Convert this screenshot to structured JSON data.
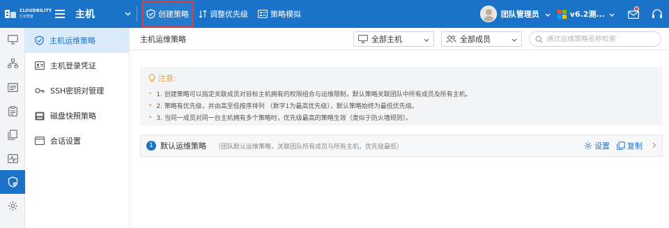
{
  "colors": {
    "brand": "#1a73c9",
    "highlight_outline": "#e23b3b",
    "notice_accent": "#e8a23a",
    "active_submenu_bg": "#dcebfa"
  },
  "logo": {
    "en": "CLOUDBILITY",
    "cn": "行云管家"
  },
  "topbar": {
    "module_title": "主机",
    "create_policy": "创建策略",
    "adjust_priority": "调整优先级",
    "policy_simulation": "策略模拟",
    "user_name": "团队管理员",
    "version": "v6.2测..."
  },
  "rail": {
    "items": [
      "monitor-icon",
      "org-tree-icon",
      "list-icon",
      "clipboard-icon",
      "copy-icon",
      "pulse-icon",
      "shield-icon",
      "settings-icon"
    ],
    "active_index": 6
  },
  "submenu": {
    "items": [
      {
        "label": "主机运维策略",
        "icon": "shield-check-icon"
      },
      {
        "label": "主机登录凭证",
        "icon": "credential-icon"
      },
      {
        "label": "SSH密钥对管理",
        "icon": "key-icon"
      },
      {
        "label": "磁盘快照策略",
        "icon": "disk-snapshot-icon"
      },
      {
        "label": "会话设置",
        "icon": "window-icon"
      }
    ],
    "active_index": 0
  },
  "main": {
    "page_title": "主机运维策略",
    "filter_hosts": "全部主机",
    "filter_members": "全部成员",
    "search_placeholder": "通过运维策略名称检索"
  },
  "notice": {
    "title": "注意:",
    "lines": [
      "1. 创建策略可以指定关联成员对目标主机拥有的权限组合与运维限制，默认策略关联团队中所有成员及所有主机。",
      "2. 策略有优先级，并由高至低按序排列 （数字1为最高优先级），默认策略始终为最低优先级。",
      "3. 当同一成员对同一台主机拥有多个策略时，优先级最高的策略生效（类似于防火墙规则）。"
    ]
  },
  "policy": {
    "number": "1",
    "name": "默认运维策略",
    "description": "（团队默认运维策略，关联团队所有成员与所有主机，优先级最低）",
    "settings_label": "设置",
    "copy_label": "复制"
  }
}
